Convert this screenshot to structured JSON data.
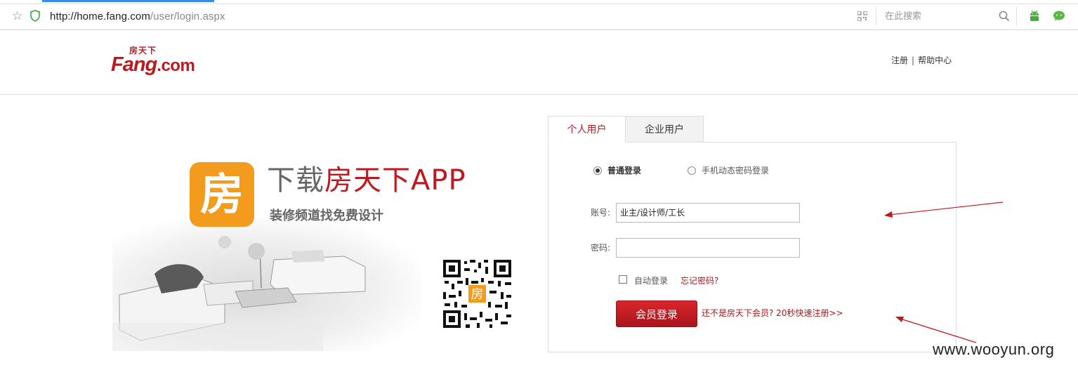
{
  "browser": {
    "url_host": "http://home.fang.com",
    "url_path": "/user/login.aspx",
    "search_placeholder": "在此搜索"
  },
  "header": {
    "logo_small": "房天下",
    "logo_main": "Fang",
    "logo_suffix": ".com",
    "links": [
      "注册",
      "帮助中心"
    ],
    "link_divider": "|"
  },
  "promo": {
    "app_icon_char": "房",
    "title_prefix": "下载",
    "title_brand": "房天下APP",
    "subtitle": "装修频道找免费设计",
    "qr_badge_char": "房"
  },
  "login": {
    "tabs": [
      "个人用户",
      "企业用户"
    ],
    "active_tab": "个人用户",
    "radio_options": [
      "普通登录",
      "手机动态密码登录"
    ],
    "selected_radio": "普通登录",
    "account_label": "账号:",
    "account_value": "业主/设计师/工长",
    "password_label": "密码:",
    "password_value": "",
    "auto_login": "自动登录",
    "forgot_password": "忘记密码?",
    "login_button": "会员登录",
    "register_link": "还不是房天下会员? 20秒快速注册>>"
  },
  "watermark": "www.wooyun.org",
  "colors": {
    "brand_red": "#c1181f",
    "app_orange": "#f29b1d",
    "link_red": "#a5171c"
  }
}
